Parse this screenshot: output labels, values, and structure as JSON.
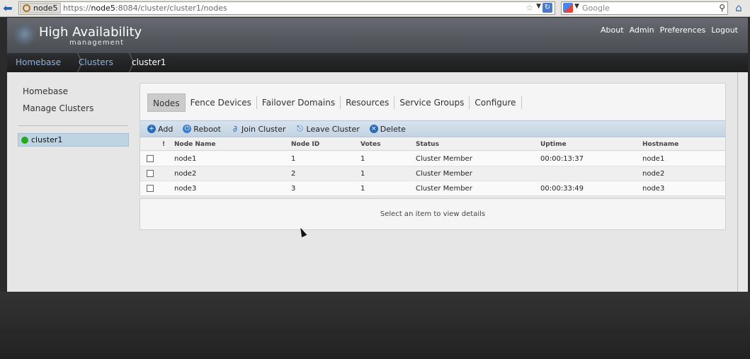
{
  "browser": {
    "site_label": "node5",
    "url_prefix": "https://",
    "url_host": "node5",
    "url_rest": ":8084/cluster/cluster1/nodes",
    "search_placeholder": "Google"
  },
  "header": {
    "title": "High Availability",
    "subtitle": "management",
    "links": [
      "About",
      "Admin",
      "Preferences",
      "Logout"
    ]
  },
  "breadcrumb": {
    "items": [
      "Homebase",
      "Clusters",
      "cluster1"
    ]
  },
  "sidebar": {
    "links": [
      "Homebase",
      "Manage Clusters"
    ],
    "cluster": {
      "name": "cluster1",
      "status_color": "#22aa1a"
    }
  },
  "tabs": [
    {
      "label": "Nodes",
      "active": true
    },
    {
      "label": "Fence Devices"
    },
    {
      "label": "Failover Domains"
    },
    {
      "label": "Resources"
    },
    {
      "label": "Service Groups"
    },
    {
      "label": "Configure"
    }
  ],
  "toolbar": {
    "add": "Add",
    "reboot": "Reboot",
    "join": "Join Cluster",
    "leave": "Leave Cluster",
    "delete": "Delete"
  },
  "table": {
    "columns": [
      "!",
      "Node Name",
      "Node ID",
      "Votes",
      "Status",
      "Uptime",
      "Hostname"
    ],
    "rows": [
      {
        "name": "node1",
        "id": "1",
        "votes": "1",
        "status": "Cluster Member",
        "uptime": "00:00:13:37",
        "hostname": "node1"
      },
      {
        "name": "node2",
        "id": "2",
        "votes": "1",
        "status": "Cluster Member",
        "uptime": "",
        "hostname": "node2"
      },
      {
        "name": "node3",
        "id": "3",
        "votes": "1",
        "status": "Cluster Member",
        "uptime": "00:00:33:49",
        "hostname": "node3"
      }
    ]
  },
  "detail": {
    "message": "Select an item to view details"
  }
}
